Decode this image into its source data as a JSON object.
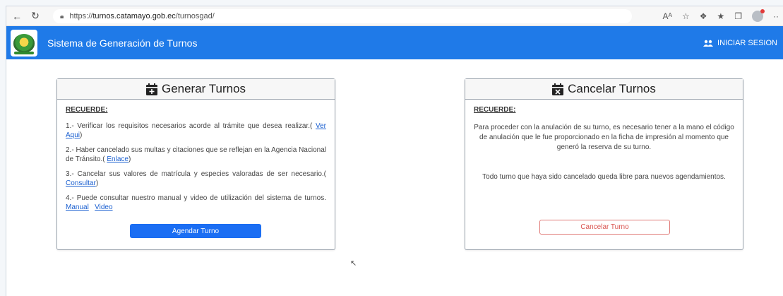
{
  "browser": {
    "url_prefix": "https://",
    "url_host": "turnos.catamayo.gob.ec",
    "url_path": "/turnosgad/",
    "reader_label": "Aᴬ"
  },
  "header": {
    "title": "Sistema de Generación de Turnos",
    "login_label": "INICIAR SESION"
  },
  "generar": {
    "title": "Generar Turnos",
    "recuerde": "RECUERDE:",
    "items": [
      {
        "text": "1.- Verificar los requisitos necesarios acorde al trámite que desea realizar.( ",
        "link": "Ver Aqui",
        "after": ")"
      },
      {
        "text": "2.- Haber cancelado sus multas y citaciones que se reflejan en la Agencia Nacional de Tránsito.( ",
        "link": "Enlace",
        "after": ")"
      },
      {
        "text": "3.- Cancelar sus valores de matrícula y especies valoradas de ser necesario.( ",
        "link": "Consultar",
        "after": ")"
      },
      {
        "text": "4.- Puede consultar nuestro manual y video de utilización del sistema de turnos. ",
        "link": "Manual",
        "link2": "Video"
      }
    ],
    "button": "Agendar Turno"
  },
  "cancelar": {
    "title": "Cancelar Turnos",
    "recuerde": "RECUERDE:",
    "paragraph1": "Para proceder con la anulación de su turno, es necesario tener a la mano el código de anulación que le fue proporcionado en la ficha de impresión al momento que generó la reserva de su turno.",
    "paragraph2": "Todo turno que haya sido cancelado queda libre para nuevos agendamientos.",
    "button": "Cancelar Turno"
  },
  "colors": {
    "header_blue": "#1f7ae8",
    "primary_button": "#1b6ef3",
    "danger": "#d9534f"
  }
}
